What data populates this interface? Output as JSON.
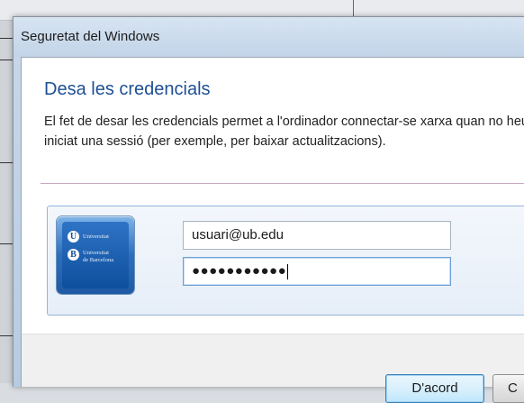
{
  "window": {
    "title": "Seguretat del Windows"
  },
  "content": {
    "heading": "Desa les credencials",
    "description": "El fet de desar les credencials permet a l'ordinador connectar-se xarxa quan no heu iniciat una sessió (per exemple, per baixar actualitzacions)."
  },
  "credentials": {
    "tile": {
      "logo_letters": [
        "U",
        "B"
      ],
      "logo_text": [
        "Universitat",
        "Universitat",
        "de Barcelona"
      ]
    },
    "username": "usuari@ub.edu",
    "password_mask": "●●●●●●●●●●●"
  },
  "buttons": {
    "ok": "D'acord",
    "cancel_partial": "C"
  },
  "colors": {
    "heading": "#1e4f94",
    "accent_border": "#94b4d8"
  }
}
